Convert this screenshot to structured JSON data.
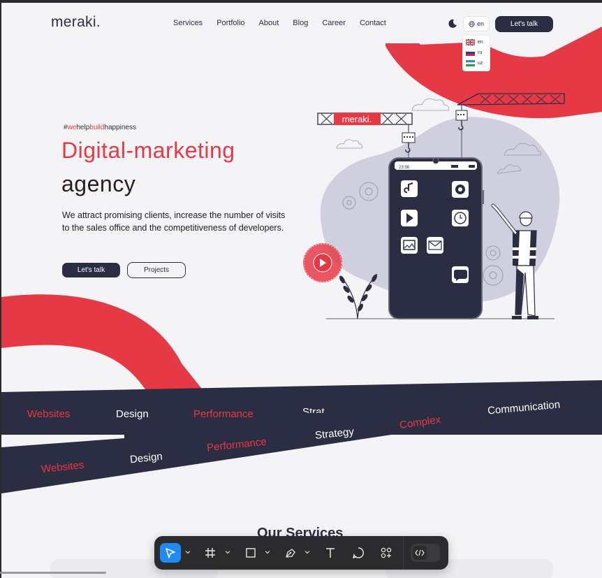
{
  "header": {
    "logo": "meraki.",
    "nav": [
      "Services",
      "Portfolio",
      "About",
      "Blog",
      "Career",
      "Contact"
    ],
    "lang_current": "en",
    "lang_options": [
      "en",
      "ru",
      "uz"
    ],
    "cta": "Let's talk"
  },
  "hero": {
    "hashtag_parts": [
      "#",
      "we",
      "help",
      "build",
      "happiness"
    ],
    "title_line1": "Digital-marketing",
    "title_line2": "agency",
    "description": "We attract promising clients, increase the number of visits to the sales office and the competitiveness of developers.",
    "btn_primary": "Let's talk",
    "btn_secondary": "Projects",
    "crane_sign": "meraki.",
    "phone_time": "23:56",
    "showreel_text": "showreel • showreel • showreel •"
  },
  "ticker": {
    "top": [
      "Websites",
      "Design",
      "Performance",
      "Strat",
      "Complex",
      "Communication"
    ],
    "bottom": [
      "Websites",
      "Design",
      "Performance",
      "Strategy"
    ]
  },
  "services_heading": "Our Services",
  "colors": {
    "accent": "#e63946",
    "navy": "#2b2d42",
    "blob": "#cfcfe0",
    "toolbar": "#2b2b2e",
    "toolbar_active": "#1e8cf5"
  },
  "toolbar": {
    "tools": [
      "move-tool",
      "frame-tool",
      "shape-tool",
      "pen-tool",
      "text-tool",
      "comment-tool",
      "components-tool",
      "dev-mode-toggle"
    ]
  }
}
